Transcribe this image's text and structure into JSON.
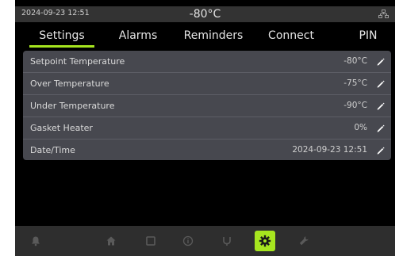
{
  "status": {
    "datetime": "2024-09-23  12:51",
    "temperature": "-80°C",
    "network_icon": "network-icon"
  },
  "tabs": [
    {
      "label": "Settings",
      "active": true
    },
    {
      "label": "Alarms"
    },
    {
      "label": "Reminders"
    },
    {
      "label": "Connect"
    },
    {
      "label": "PIN"
    }
  ],
  "settings": [
    {
      "label": "Setpoint Temperature",
      "value": "-80°C"
    },
    {
      "label": "Over Temperature",
      "value": "-75°C"
    },
    {
      "label": "Under Temperature",
      "value": "-90°C"
    },
    {
      "label": "Gasket Heater",
      "value": "0%"
    },
    {
      "label": "Date/Time",
      "value": "2024-09-23  12:51"
    }
  ],
  "nav": [
    {
      "icon": "bell-icon"
    },
    {
      "icon": "home-icon"
    },
    {
      "icon": "display-icon"
    },
    {
      "icon": "info-icon"
    },
    {
      "icon": "usb-icon"
    },
    {
      "icon": "gear-icon",
      "active": true
    },
    {
      "icon": "wrench-icon"
    }
  ],
  "colors": {
    "accent": "#a6e51f",
    "panel": "#47484f",
    "statusbar": "#333333",
    "background": "#000000"
  }
}
